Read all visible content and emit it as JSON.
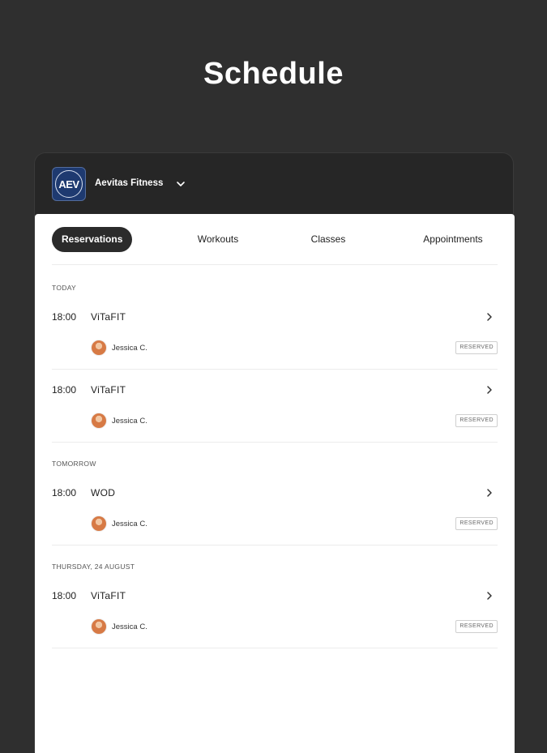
{
  "page": {
    "title": "Schedule"
  },
  "header": {
    "gym_name": "Aevitas Fitness",
    "logo_text": "AEV"
  },
  "tabs": [
    {
      "label": "Reservations",
      "active": true
    },
    {
      "label": "Workouts",
      "active": false
    },
    {
      "label": "Classes",
      "active": false
    },
    {
      "label": "Appointments",
      "active": false
    }
  ],
  "sections": [
    {
      "label": "TODAY",
      "items": [
        {
          "time": "18:00",
          "name": "ViTaFIT",
          "member": "Jessica C.",
          "status": "RESERVED"
        },
        {
          "time": "18:00",
          "name": "ViTaFIT",
          "member": "Jessica C.",
          "status": "RESERVED"
        }
      ]
    },
    {
      "label": "TOMORROW",
      "items": [
        {
          "time": "18:00",
          "name": "WOD",
          "member": "Jessica C.",
          "status": "RESERVED"
        }
      ]
    },
    {
      "label": "THURSDAY, 24 AUGUST",
      "items": [
        {
          "time": "18:00",
          "name": "ViTaFIT",
          "member": "Jessica C.",
          "status": "RESERVED"
        }
      ]
    }
  ],
  "colors": {
    "background": "#2f2f2f",
    "active_tab": "#2b2b2b",
    "logo_bg": "#1e3a70"
  },
  "icons": {
    "gym_selector": "chevron-down-icon",
    "row_action": "chevron-right-icon"
  }
}
